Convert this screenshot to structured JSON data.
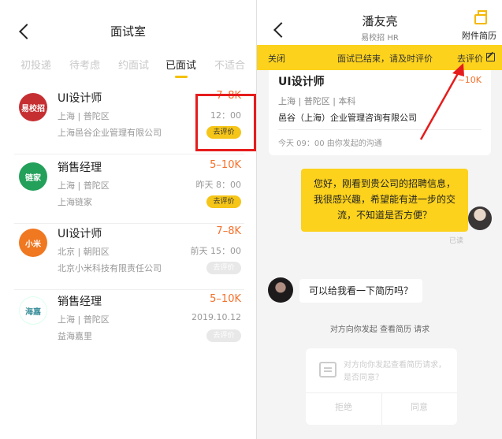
{
  "left": {
    "title": "面试室",
    "tabs": [
      "初投递",
      "待考虑",
      "约面试",
      "已面试",
      "不适合"
    ],
    "items": [
      {
        "logo": "易校招",
        "logo_color": "#c62f32",
        "title": "UI设计师",
        "salary": "7–8K",
        "location": "上海 | 普陀区",
        "company": "上海邑谷企业管理有限公司",
        "time": "12：00",
        "eval": "去评价",
        "active": true
      },
      {
        "logo": "链家",
        "logo_color": "#23a05a",
        "title": "销售经理",
        "salary": "5–10K",
        "location": "上海 | 普陀区",
        "company": "上海链家",
        "time": "昨天 8：00",
        "eval": "去评价",
        "active": true
      },
      {
        "logo": "小米",
        "logo_color": "#f07820",
        "title": "UI设计师",
        "salary": "7–8K",
        "location": "北京 | 朝阳区",
        "company": "北京小米科技有限责任公司",
        "time": "前天 15：00",
        "eval": "去评价",
        "active": false
      },
      {
        "logo": "海嘉",
        "logo_color": "#3a8f9a",
        "title": "销售经理",
        "salary": "5–10K",
        "location": "上海 | 普陀区",
        "company": "益海嘉里",
        "time": "2019.10.12",
        "eval": "去评价",
        "active": false
      }
    ]
  },
  "right": {
    "name": "潘友亮",
    "subtitle": "易校招 HR",
    "attach": "附件简历",
    "bar": {
      "close": "关闭",
      "message": "面试已结束，请及时评价",
      "eval": "去评价"
    },
    "job": {
      "title": "UI设计师",
      "salary": "~10K",
      "location": "上海 | 普陀区 | 本科",
      "company": "邑谷（上海）企业管理咨询有限公司",
      "time": "今天 09：00 由你发起的沟通"
    },
    "msg_mine": "您好，刚看到贵公司的招聘信息，我很感兴趣，希望能有进一步的交流，不知道是否方便？",
    "read": "已读",
    "msg_hr": "可以给我看一下简历吗？",
    "system": "对方向你发起 查看简历 请求",
    "request": {
      "text": "对方向你发起查看简历请求，是否同意？",
      "reject": "拒绝",
      "agree": "同意"
    }
  }
}
